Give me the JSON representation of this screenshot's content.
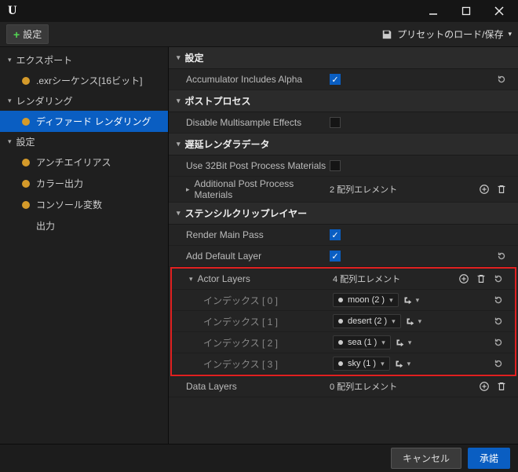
{
  "titlebar": {
    "logo": "U"
  },
  "toolbar": {
    "add_label": "設定",
    "preset_label": "プリセットのロード/保存"
  },
  "sidebar": {
    "groups": [
      {
        "label": "エクスポート"
      },
      {
        "label": "レンダリング"
      },
      {
        "label": "設定"
      }
    ],
    "items": {
      "export_exr": ".exrシーケンス[16ビット]",
      "render_deferred": "ディファード レンダリング",
      "set_antialias": "アンチエイリアス",
      "set_color": "カラー出力",
      "set_console": "コンソール変数",
      "set_output": "出力"
    }
  },
  "details": {
    "sections": {
      "settings": "設定",
      "postprocess": "ポストプロセス",
      "deferred": "遅延レンダラデータ",
      "stencil": "ステンシルクリップレイヤー"
    },
    "rows": {
      "accum_alpha": "Accumulator Includes Alpha",
      "disable_multi": "Disable Multisample Effects",
      "use32": "Use 32Bit Post Process Materials",
      "addl_mat": "Additional Post Process Materials",
      "addl_mat_val": "2 配列エレメント",
      "render_main": "Render Main Pass",
      "add_default": "Add Default Layer",
      "actor_layers": "Actor Layers",
      "actor_layers_val": "4 配列エレメント",
      "idx0": "インデックス [ 0 ]",
      "idx0_v": "moon (2 )",
      "idx1": "インデックス [ 1 ]",
      "idx1_v": "desert (2 )",
      "idx2": "インデックス [ 2 ]",
      "idx2_v": "sea (1 )",
      "idx3": "インデックス [ 3 ]",
      "idx3_v": "sky (1 )",
      "data_layers": "Data Layers",
      "data_layers_val": "0 配列エレメント"
    }
  },
  "footer": {
    "cancel": "キャンセル",
    "accept": "承諾"
  }
}
